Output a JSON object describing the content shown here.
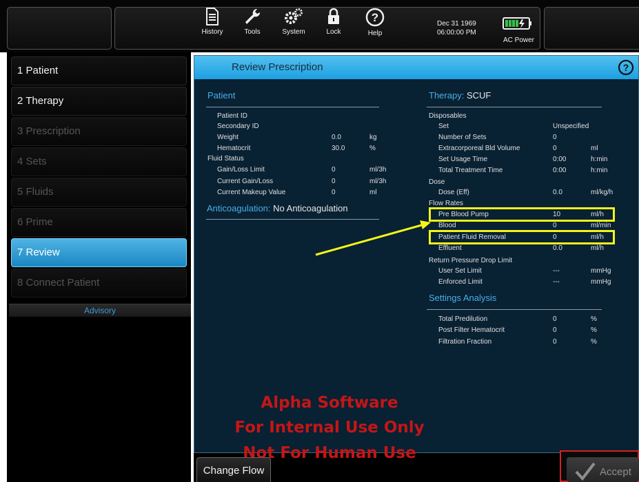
{
  "toolbar": {
    "buttons": [
      {
        "label": "History"
      },
      {
        "label": "Tools"
      },
      {
        "label": "System"
      },
      {
        "label": "Lock"
      },
      {
        "label": "Help"
      }
    ],
    "date": "Dec 31 1969",
    "time": "06:00:00 PM",
    "power_label": "AC Power"
  },
  "sidebar": {
    "steps": [
      {
        "label": "1 Patient",
        "state": "enabled"
      },
      {
        "label": "2 Therapy",
        "state": "enabled"
      },
      {
        "label": "3 Prescription",
        "state": "disabled"
      },
      {
        "label": "4 Sets",
        "state": "disabled"
      },
      {
        "label": "5 Fluids",
        "state": "disabled"
      },
      {
        "label": "6 Prime",
        "state": "disabled"
      },
      {
        "label": "7 Review",
        "state": "active"
      },
      {
        "label": "8 Connect Patient",
        "state": "disabled"
      }
    ],
    "advisory_label": "Advisory"
  },
  "panel": {
    "title": "Review Prescription",
    "patient": {
      "heading": "Patient",
      "rows": [
        {
          "label": "Patient ID",
          "value": "",
          "unit": ""
        },
        {
          "label": "Secondary ID",
          "value": "",
          "unit": ""
        },
        {
          "label": "Weight",
          "value": "0.0",
          "unit": "kg"
        },
        {
          "label": "Hematocrit",
          "value": "30.0",
          "unit": "%"
        },
        {
          "label": "Fluid Status",
          "value": "",
          "unit": ""
        },
        {
          "label": "Gain/Loss Limit",
          "value": "0",
          "unit": "ml/3h"
        },
        {
          "label": "Current Gain/Loss",
          "value": "0",
          "unit": "ml/3h"
        },
        {
          "label": "Current Makeup Value",
          "value": "0",
          "unit": "ml"
        }
      ]
    },
    "anticoagulation": {
      "heading": "Anticoagulation:",
      "value": "No Anticoagulation"
    },
    "therapy": {
      "heading": "Therapy:",
      "value": "SCUF",
      "disposables": "Disposables",
      "disposables_rows": [
        {
          "label": "Set",
          "value": "Unspecified",
          "unit": ""
        },
        {
          "label": "Number of Sets",
          "value": "0",
          "unit": ""
        },
        {
          "label": "Extracorporeal Bld Volume",
          "value": "0",
          "unit": "ml"
        },
        {
          "label": "Set Usage Time",
          "value": "0:00",
          "unit": "h:min"
        },
        {
          "label": "Total Treatment Time",
          "value": "0:00",
          "unit": "h:min"
        }
      ],
      "dose": "Dose",
      "dose_rows": [
        {
          "label": "Dose (Eff)",
          "value": "0.0",
          "unit": "ml/kg/h"
        }
      ],
      "flow_rates": "Flow Rates",
      "flow_rows": [
        {
          "label": "Pre Blood Pump",
          "value": "10",
          "unit": "ml/h"
        },
        {
          "label": "Blood",
          "value": "0",
          "unit": "ml/min"
        },
        {
          "label": "Patient Fluid Removal",
          "value": "0",
          "unit": "ml/h"
        },
        {
          "label": "Effluent",
          "value": "0.0",
          "unit": "ml/h"
        }
      ],
      "return_pressure": "Return Pressure Drop Limit",
      "return_rows": [
        {
          "label": "User Set Limit",
          "value": "---",
          "unit": "mmHg"
        },
        {
          "label": "Enforced Limit",
          "value": "---",
          "unit": "mmHg"
        }
      ]
    },
    "settings_analysis": {
      "heading": "Settings Analysis",
      "rows": [
        {
          "label": "Total Predilution",
          "value": "0",
          "unit": "%"
        },
        {
          "label": "Post Filter Hematocrit",
          "value": "0",
          "unit": "%"
        },
        {
          "label": "Filtration Fraction",
          "value": "0",
          "unit": "%"
        }
      ]
    }
  },
  "watermark": [
    "Alpha Software",
    "For Internal Use Only",
    "Not For Human Use"
  ],
  "footer": {
    "change_flow_label": "Change Flow",
    "accept_label": "Accept"
  },
  "colors": {
    "accent": "#1da0e2",
    "highlight": "#f4f41a",
    "watermark": "#c41616",
    "panel_bg": "#082133"
  }
}
